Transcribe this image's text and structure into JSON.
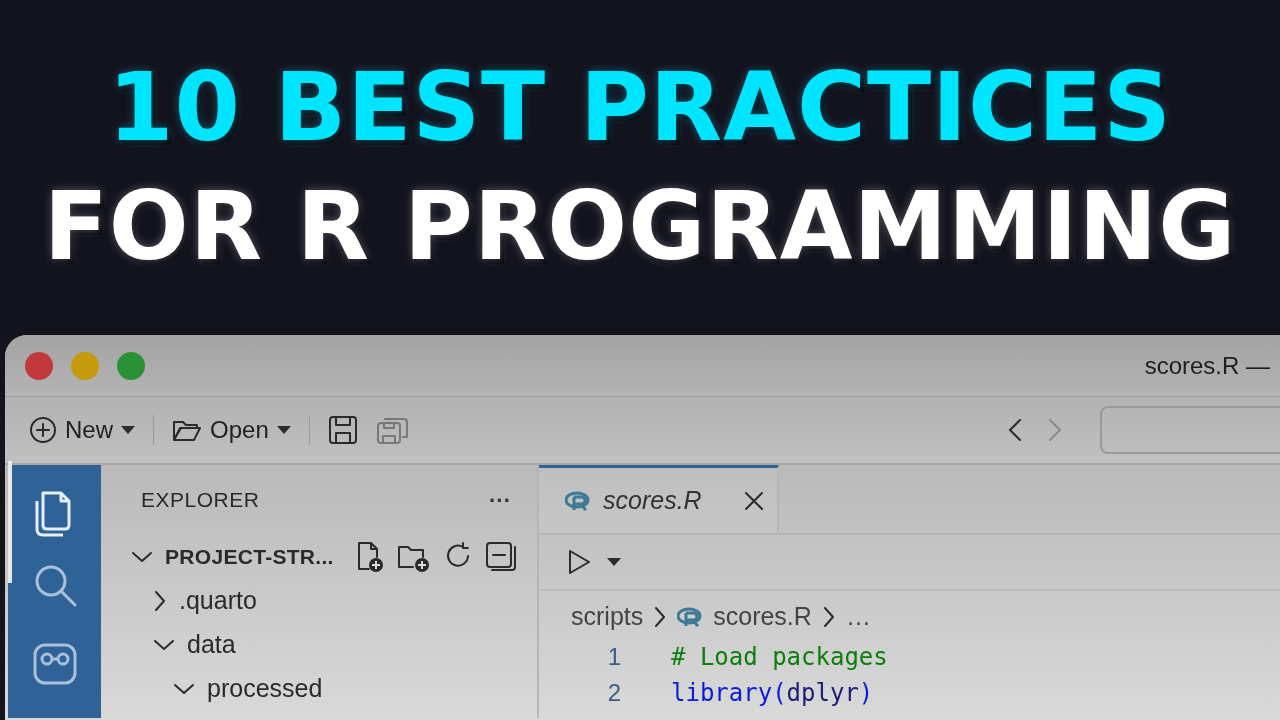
{
  "headline": {
    "line_1": "10 BEST PRACTICES",
    "line_2": "FOR R PROGRAMMING"
  },
  "window": {
    "title": "scores.R —"
  },
  "toolbar": {
    "buttons": [
      {
        "label": "New",
        "dropdown": true,
        "disabled": false
      },
      {
        "label": "Open",
        "dropdown": true,
        "disabled": false
      },
      {
        "dropdown": false,
        "disabled": false
      },
      {
        "dropdown": false,
        "disabled": true
      }
    ],
    "nav": [
      {
        "disabled": false
      },
      {
        "disabled": true
      }
    ]
  },
  "activity_bar": [
    {
      "selected": true
    },
    {
      "selected": false
    },
    {
      "selected": false
    }
  ],
  "explorer": {
    "title": "EXPLORER",
    "more": "···",
    "tree": [
      {
        "label": "PROJECT-STR...",
        "expanded": true,
        "children": [
          {
            "label": ".quarto",
            "expanded": false
          },
          {
            "label": "data",
            "expanded": true,
            "children": [
              {
                "label": "processed",
                "expanded": true
              }
            ]
          }
        ]
      }
    ]
  },
  "editor": {
    "tabs": [
      {
        "label": "scores.R",
        "selected": true
      }
    ],
    "breadcrumb": [
      "scripts",
      "scores.R",
      "…"
    ],
    "lines": [
      {
        "number": "1",
        "tokens": [
          {
            "kind": "comment",
            "text": "# Load packages"
          }
        ]
      },
      {
        "number": "2",
        "tokens": [
          {
            "kind": "function",
            "text": "library("
          },
          {
            "kind": "arg",
            "text": "dplyr"
          },
          {
            "kind": "function",
            "text": ")"
          }
        ]
      }
    ]
  }
}
